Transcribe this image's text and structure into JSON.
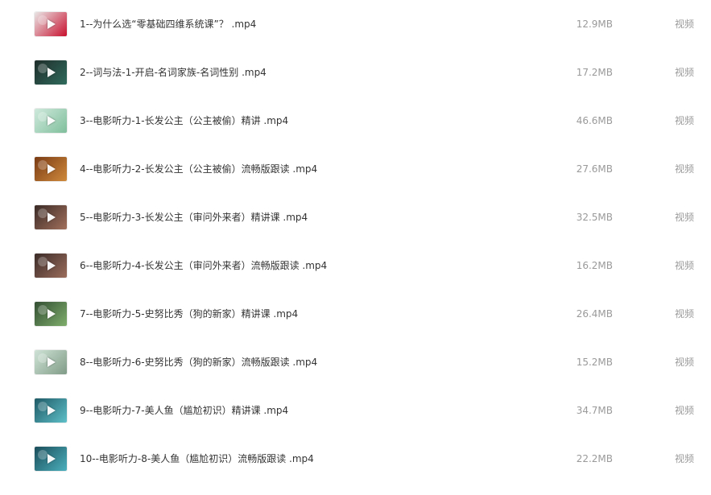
{
  "files": [
    {
      "name": "1--为什么选“零基础四维系统课”？ .mp4",
      "size": "12.9MB",
      "type": "视频",
      "thumb_icon": "flower-thumbnail-icon",
      "thumb_colors": [
        "#e9e6e6",
        "#c8102e"
      ]
    },
    {
      "name": "2--词与法-1-开启-名词家族-名词性别 .mp4",
      "size": "17.2MB",
      "type": "视频",
      "thumb_icon": "chalkboard-thumbnail-icon",
      "thumb_colors": [
        "#1f2d2a",
        "#2f6b5c"
      ]
    },
    {
      "name": "3--电影听力-1-长发公主（公主被偷）精讲 .mp4",
      "size": "46.6MB",
      "type": "视频",
      "thumb_icon": "cartoon-person-thumbnail-icon",
      "thumb_colors": [
        "#cfe9dc",
        "#7fbf9c"
      ]
    },
    {
      "name": "4--电影听力-2-长发公主（公主被偷）流畅版跟读 .mp4",
      "size": "27.6MB",
      "type": "视频",
      "thumb_icon": "movie-scene-thumbnail-icon",
      "thumb_colors": [
        "#7a3b14",
        "#d08a3c"
      ]
    },
    {
      "name": "5--电影听力-3-长发公主（审问外来者）精讲课 .mp4",
      "size": "32.5MB",
      "type": "视频",
      "thumb_icon": "movie-scene-thumbnail-icon",
      "thumb_colors": [
        "#3a2a26",
        "#a2705c"
      ]
    },
    {
      "name": "6--电影听力-4-长发公主（审问外来者）流畅版跟读 .mp4",
      "size": "16.2MB",
      "type": "视频",
      "thumb_icon": "movie-scene-thumbnail-icon",
      "thumb_colors": [
        "#3b2b28",
        "#9b6d5c"
      ]
    },
    {
      "name": "7--电影听力-5-史努比秀（狗的新家）精讲课 .mp4",
      "size": "26.4MB",
      "type": "视频",
      "thumb_icon": "cartoon-scene-thumbnail-icon",
      "thumb_colors": [
        "#334f33",
        "#7fae6c"
      ]
    },
    {
      "name": "8--电影听力-6-史努比秀（狗的新家）流畅版跟读 .mp4",
      "size": "15.2MB",
      "type": "视频",
      "thumb_icon": "cartoon-scene-thumbnail-icon",
      "thumb_colors": [
        "#cfe3d6",
        "#7f9b86"
      ]
    },
    {
      "name": "9--电影听力-7-美人鱼（尴尬初识）精讲课 .mp4",
      "size": "34.7MB",
      "type": "视频",
      "thumb_icon": "mermaid-scene-thumbnail-icon",
      "thumb_colors": [
        "#1e5a66",
        "#5ec0c9"
      ]
    },
    {
      "name": "10--电影听力-8-美人鱼（尴尬初识）流畅版跟读 .mp4",
      "size": "22.2MB",
      "type": "视频",
      "thumb_icon": "mermaid-scene-thumbnail-icon",
      "thumb_colors": [
        "#1b4d5a",
        "#4bb0bd"
      ]
    }
  ]
}
